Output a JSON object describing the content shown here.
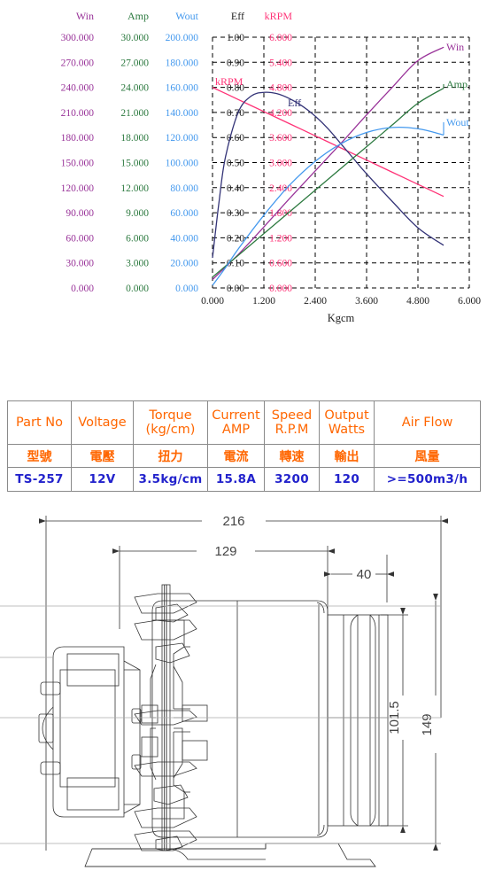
{
  "chart_data": {
    "type": "line",
    "title": "",
    "xlabel": "Kgcm",
    "xlim": [
      0,
      6
    ],
    "xticks": [
      "0.000",
      "1.200",
      "2.400",
      "3.600",
      "4.800",
      "6.000"
    ],
    "grid": true,
    "legend_position": "right-inside",
    "axes": [
      {
        "name": "Win",
        "color": "#993399",
        "ticks": [
          "300.000",
          "270.000",
          "240.000",
          "210.000",
          "180.000",
          "150.000",
          "120.000",
          "90.000",
          "60.000",
          "30.000",
          "0.000"
        ],
        "lim": [
          0,
          300
        ]
      },
      {
        "name": "Amp",
        "color": "#2d7a40",
        "ticks": [
          "30.000",
          "27.000",
          "24.000",
          "21.000",
          "18.000",
          "15.000",
          "12.000",
          "9.000",
          "6.000",
          "3.000",
          "0.000"
        ],
        "lim": [
          0,
          30
        ]
      },
      {
        "name": "Wout",
        "color": "#4499ee",
        "ticks": [
          "200.000",
          "180.000",
          "160.000",
          "140.000",
          "120.000",
          "100.000",
          "80.000",
          "60.000",
          "40.000",
          "20.000",
          "0.000"
        ],
        "lim": [
          0,
          200
        ]
      },
      {
        "name": "Eff",
        "color": "#222222",
        "ticks": [
          "1.00",
          "0.90",
          "0.80",
          "0.70",
          "0.60",
          "0.50",
          "0.40",
          "0.30",
          "0.20",
          "0.10",
          "0.00"
        ],
        "lim": [
          0,
          1
        ]
      },
      {
        "name": "kRPM",
        "color": "#ff3377",
        "ticks": [
          "6.000",
          "5.400",
          "4.800",
          "4.200",
          "3.600",
          "3.000",
          "2.400",
          "1.800",
          "1.200",
          "0.600",
          "0.000"
        ],
        "lim": [
          0,
          6
        ]
      }
    ],
    "series": [
      {
        "name": "kRPM",
        "label": "kRPM",
        "color": "#ff3377",
        "axis": "kRPM",
        "x": [
          0.0,
          0.6,
          1.2,
          1.8,
          2.4,
          3.0,
          3.6,
          4.2,
          4.8,
          5.4
        ],
        "y": [
          4.8,
          4.51,
          4.22,
          3.93,
          3.64,
          3.35,
          3.06,
          2.77,
          2.48,
          2.19
        ]
      },
      {
        "name": "Eff",
        "label": "Eff",
        "color": "#333377",
        "axis": "Eff",
        "x": [
          0.0,
          0.15,
          0.3,
          0.6,
          0.9,
          1.2,
          1.5,
          1.8,
          2.1,
          2.4,
          2.7,
          3.0,
          3.3,
          3.6,
          4.2,
          4.8,
          5.4
        ],
        "y": [
          0.12,
          0.34,
          0.52,
          0.7,
          0.765,
          0.78,
          0.775,
          0.755,
          0.725,
          0.685,
          0.635,
          0.575,
          0.515,
          0.455,
          0.345,
          0.24,
          0.17
        ]
      },
      {
        "name": "Win",
        "label": "Win",
        "color": "#993399",
        "axis": "Win",
        "x": [
          0.0,
          0.6,
          1.2,
          1.8,
          2.4,
          3.0,
          3.6,
          4.2,
          4.8,
          5.4
        ],
        "y": [
          10,
          40,
          73,
          107,
          140,
          173,
          207,
          240,
          272,
          288
        ]
      },
      {
        "name": "Amp",
        "label": "Amp",
        "color": "#2d7a40",
        "axis": "Amp",
        "x": [
          0.0,
          0.6,
          1.2,
          1.8,
          2.4,
          3.0,
          3.6,
          4.2,
          4.8,
          5.4
        ],
        "y": [
          1.3,
          3.9,
          6.5,
          9.1,
          11.7,
          14.3,
          16.9,
          19.5,
          22.1,
          23.9
        ]
      },
      {
        "name": "Wout",
        "label": "Wout",
        "color": "#4499ee",
        "axis": "Wout",
        "x": [
          0.0,
          0.3,
          0.6,
          1.2,
          1.8,
          2.4,
          3.0,
          3.6,
          4.2,
          4.8,
          5.4
        ],
        "y": [
          2,
          16,
          31,
          58,
          82,
          101,
          115,
          124,
          128,
          127,
          122
        ]
      }
    ],
    "annotations": [
      {
        "text": "kRPM",
        "color": "#ff3377"
      },
      {
        "text": "Eff",
        "color": "#333377"
      },
      {
        "text": "Win",
        "color": "#993399"
      },
      {
        "text": "Amp",
        "color": "#2d7a40"
      },
      {
        "text": "Wout",
        "color": "#4499ee"
      }
    ]
  },
  "spec_table": {
    "headers_en": [
      {
        "l1": "Part No",
        "l2": ""
      },
      {
        "l1": "Voltage",
        "l2": ""
      },
      {
        "l1": "Torque",
        "l2": "(kg/cm)"
      },
      {
        "l1": "Current",
        "l2": "AMP"
      },
      {
        "l1": "Speed",
        "l2": "R.P.M"
      },
      {
        "l1": "Output",
        "l2": "Watts"
      },
      {
        "l1": "Air  Flow",
        "l2": ""
      }
    ],
    "headers_cn": [
      "型號",
      "電壓",
      "扭力",
      "電流",
      "轉速",
      "輸出",
      "風量"
    ],
    "values": [
      "TS-257",
      "12V",
      "3.5kg/cm",
      "15.8A",
      "3200",
      "120",
      ">=500m3/h"
    ],
    "colors": {
      "header": "#ff6600",
      "value": "#2222cc",
      "border": "#8a8a8a"
    }
  },
  "drawing": {
    "dimensions": {
      "overall_width": "216",
      "body_width": "129",
      "outlet_width": "40",
      "outlet_height": "101.5",
      "overall_height": "149"
    },
    "line_color": "#333333"
  }
}
